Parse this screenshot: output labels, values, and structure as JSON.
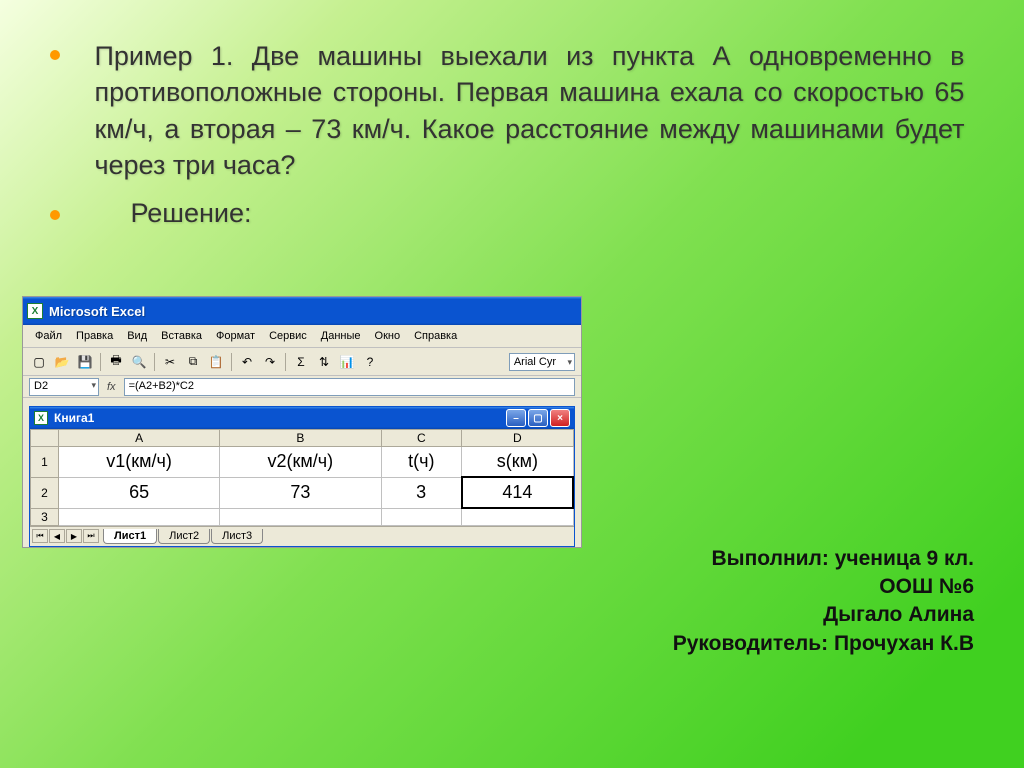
{
  "problem": {
    "text": "Пример 1. Две машины выехали из пункта А одновременно в противоположные стороны. Первая машина ехала со скоростью 65 км/ч, а вторая – 73 км/ч. Какое расстояние между машинами будет через три часа?",
    "solution_label": "Решение:"
  },
  "excel": {
    "app_title": "Microsoft Excel",
    "menus": [
      "Файл",
      "Правка",
      "Вид",
      "Вставка",
      "Формат",
      "Сервис",
      "Данные",
      "Окно",
      "Справка"
    ],
    "font_name": "Arial Cyr",
    "name_box": "D2",
    "formula": "=(A2+B2)*C2",
    "workbook_title": "Книга1",
    "columns": [
      "A",
      "B",
      "C",
      "D"
    ],
    "headers": {
      "A": "v1(км/ч)",
      "B": "v2(км/ч)",
      "C": "t(ч)",
      "D": "s(км)"
    },
    "row2": {
      "A": "65",
      "B": "73",
      "C": "3",
      "D": "414"
    },
    "sheets": [
      "Лист1",
      "Лист2",
      "Лист3"
    ],
    "active_sheet": "Лист1"
  },
  "credits": {
    "line1": "Выполнил: ученица 9 кл.",
    "line2": "ООШ №6",
    "line3": "Дыгало Алина",
    "line4": "Руководитель: Прочухан К.В"
  },
  "chart_data": {
    "type": "table",
    "title": "Решение задачи в Excel",
    "columns": [
      "v1(км/ч)",
      "v2(км/ч)",
      "t(ч)",
      "s(км)"
    ],
    "rows": [
      [
        65,
        73,
        3,
        414
      ]
    ],
    "formula_cell": "D2",
    "formula": "=(A2+B2)*C2"
  }
}
